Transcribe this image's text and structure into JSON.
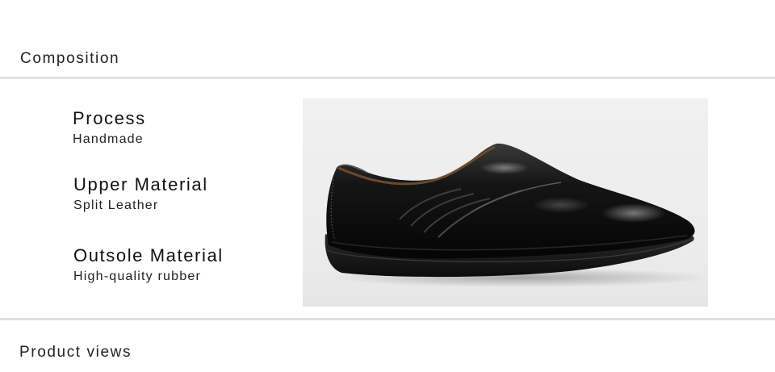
{
  "sections": {
    "composition_title": "Composition",
    "product_views_title": "Product views"
  },
  "specs": [
    {
      "label": "Process",
      "value": "Handmade"
    },
    {
      "label": "Upper Material",
      "value": "Split Leather"
    },
    {
      "label": "Outsole Material",
      "value": "High-quality rubber"
    }
  ],
  "image": {
    "icon": "black-leather-loafer-image",
    "colors": {
      "background": "#ececec",
      "shoe": "#0e0e0e",
      "sole": "#1c1c1c"
    }
  }
}
